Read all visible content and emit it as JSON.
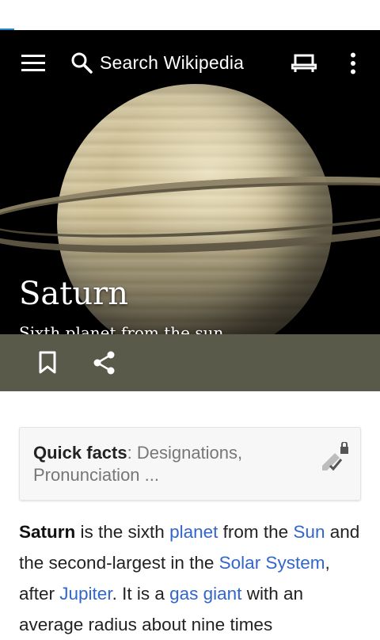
{
  "toolbar": {
    "search_placeholder": "Search Wikipedia",
    "menu_icon": "hamburger-menu-icon",
    "search_icon": "search-icon",
    "reading_icon": "reading-list-icon",
    "overflow_icon": "more-vertical-icon"
  },
  "hero": {
    "title": "Saturn",
    "subtitle": "Sixth planet from the sun"
  },
  "actions": {
    "bookmark_icon": "bookmark-icon",
    "share_icon": "share-icon"
  },
  "quick_facts": {
    "label": "Quick facts",
    "separator": ": ",
    "items": "Designations, Pronunciation ...",
    "edit_icon": "edit-locked-icon"
  },
  "article": {
    "segments": [
      {
        "text": "Saturn",
        "style": "bold"
      },
      {
        "text": " is the sixth ",
        "style": "plain"
      },
      {
        "text": "planet",
        "style": "link"
      },
      {
        "text": " from the ",
        "style": "plain"
      },
      {
        "text": "Sun",
        "style": "link"
      },
      {
        "text": " and the second-largest in the ",
        "style": "plain"
      },
      {
        "text": "Solar System",
        "style": "link"
      },
      {
        "text": ", after ",
        "style": "plain"
      },
      {
        "text": "Jupiter",
        "style": "link"
      },
      {
        "text": ". It is a ",
        "style": "plain"
      },
      {
        "text": "gas giant",
        "style": "link"
      },
      {
        "text": " with an average radius about nine times",
        "style": "plain"
      }
    ]
  },
  "colors": {
    "link": "#3366cc",
    "action_bar": "#5a5a4a",
    "status_accent": "#1e88c9"
  }
}
